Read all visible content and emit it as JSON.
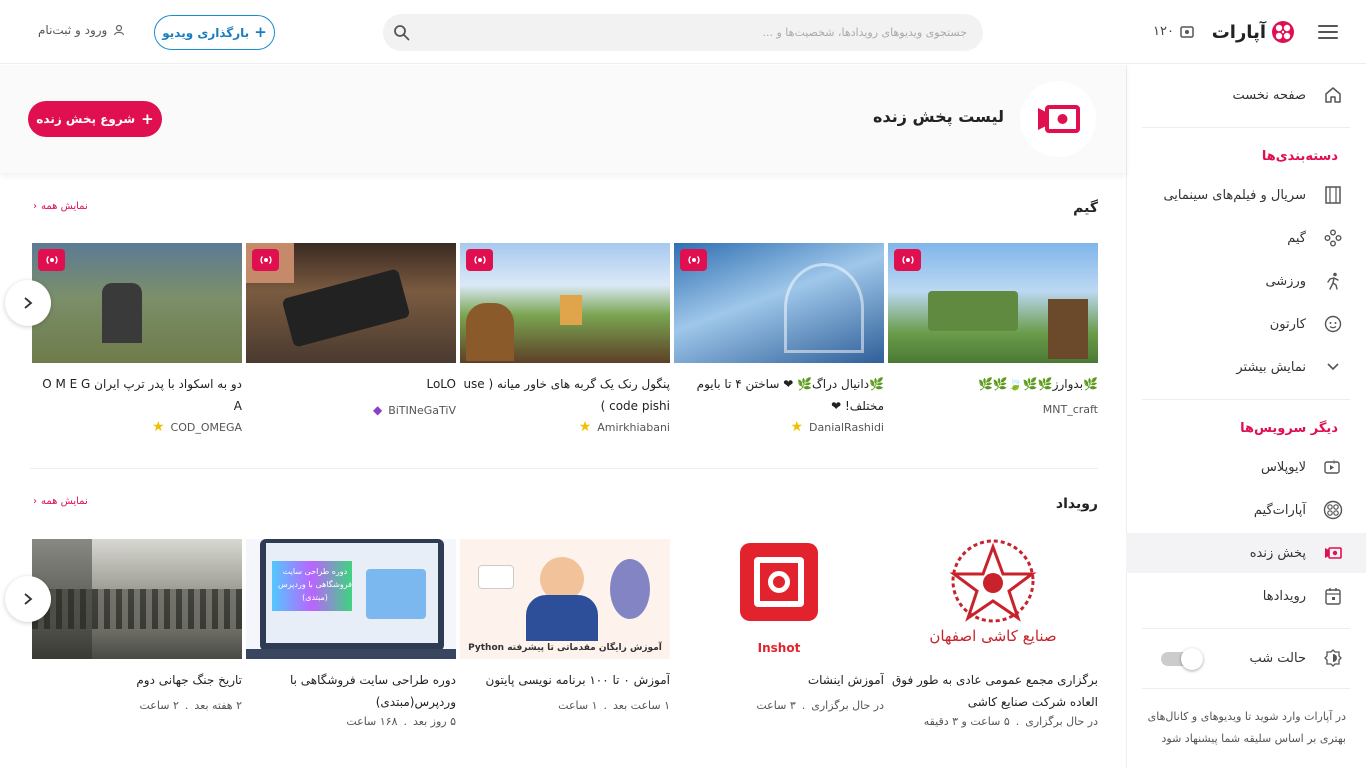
{
  "header": {
    "logo_text": "آپارات",
    "counter": "۱۲۰",
    "search_placeholder": "جستجوی ویدیوهای رویدادها، شخصیت‌ها و ...",
    "upload_label": "بارگذاری ویدیو",
    "login_label": "ورود و ثبت‌نام"
  },
  "sidebar": {
    "home": "صفحه نخست",
    "categories_heading": "دسته‌بندی‌ها",
    "categories": [
      "سریال و فیلم‌های سینمایی",
      "گیم",
      "ورزشی",
      "کارتون",
      "نمایش بیشتر"
    ],
    "services_heading": "دیگر سرویس‌ها",
    "services": [
      "لایوپلاس",
      "آپارات‌گیم",
      "پخش زنده",
      "رویدادها"
    ],
    "night_mode": "حالت شب",
    "note": "در آپارات وارد شوید تا ویدیوهای و کانال‌های بهتری بر اساس سلیقه شما پیشنهاد شود"
  },
  "banner": {
    "title": "لیست پخش زنده",
    "start_live": "شروع پخش زنده"
  },
  "game_section": {
    "title": "گیم",
    "show_all": "نمایش همه",
    "cards": [
      {
        "title": "🌿بدوارز🌿🌿🍃🌿🌿",
        "channel": "MNT_craft"
      },
      {
        "title": "🌿دانیال دراگ🌿 ❤ ساختن ۴ تا بایوم مختلف! ❤",
        "channel": "DanialRashidi"
      },
      {
        "title": "پنگول رنک یک گربه های خاور میانه ( use code pishi )",
        "channel": "Amirkhiabani"
      },
      {
        "title": "LoLO",
        "channel": "BiTINeGaTiV"
      },
      {
        "title": "دو به اسکواد با پدر ترپ ایران O M E G A",
        "channel": "COD_OMEGA"
      }
    ]
  },
  "event_section": {
    "title": "رویداد",
    "show_all": "نمایش همه",
    "cards": [
      {
        "title": "برگزاری مجمع عمومی عادی به طور فوق العاده شرکت صنایع کاشی",
        "meta_a": "در حال برگزاری",
        "meta_b": "۵ ساعت و ۳ دقیقه",
        "thumb_text": "صنایع کاشی اصفهان"
      },
      {
        "title": "آموزش اینشات",
        "meta_a": "در حال برگزاری",
        "meta_b": "۳ ساعت",
        "thumb_text": "Inshot"
      },
      {
        "title": "آموزش ۰ تا ۱۰۰ برنامه نویسی پایتون",
        "meta_a": "۱ ساعت بعد",
        "meta_b": "۱ ساعت",
        "thumb_text": "آموزش رایگان مقدماتی تا پیشرفته Python"
      },
      {
        "title": "دوره طراحی سایت فروشگاهی با وردپرس(مبتدی)",
        "meta_a": "۵ روز بعد",
        "meta_b": "۱۶۸ ساعت",
        "thumb_text": "دوره طراحی سایت فروشگاهی با وردپرس (مبتدی)"
      },
      {
        "title": "تاریخ جنگ جهانی دوم",
        "meta_a": "۲ هفته بعد",
        "meta_b": "۲ ساعت",
        "thumb_text": ""
      }
    ]
  },
  "colors": {
    "brand": "#df0f50",
    "upload_blue": "#1a8ccf"
  }
}
